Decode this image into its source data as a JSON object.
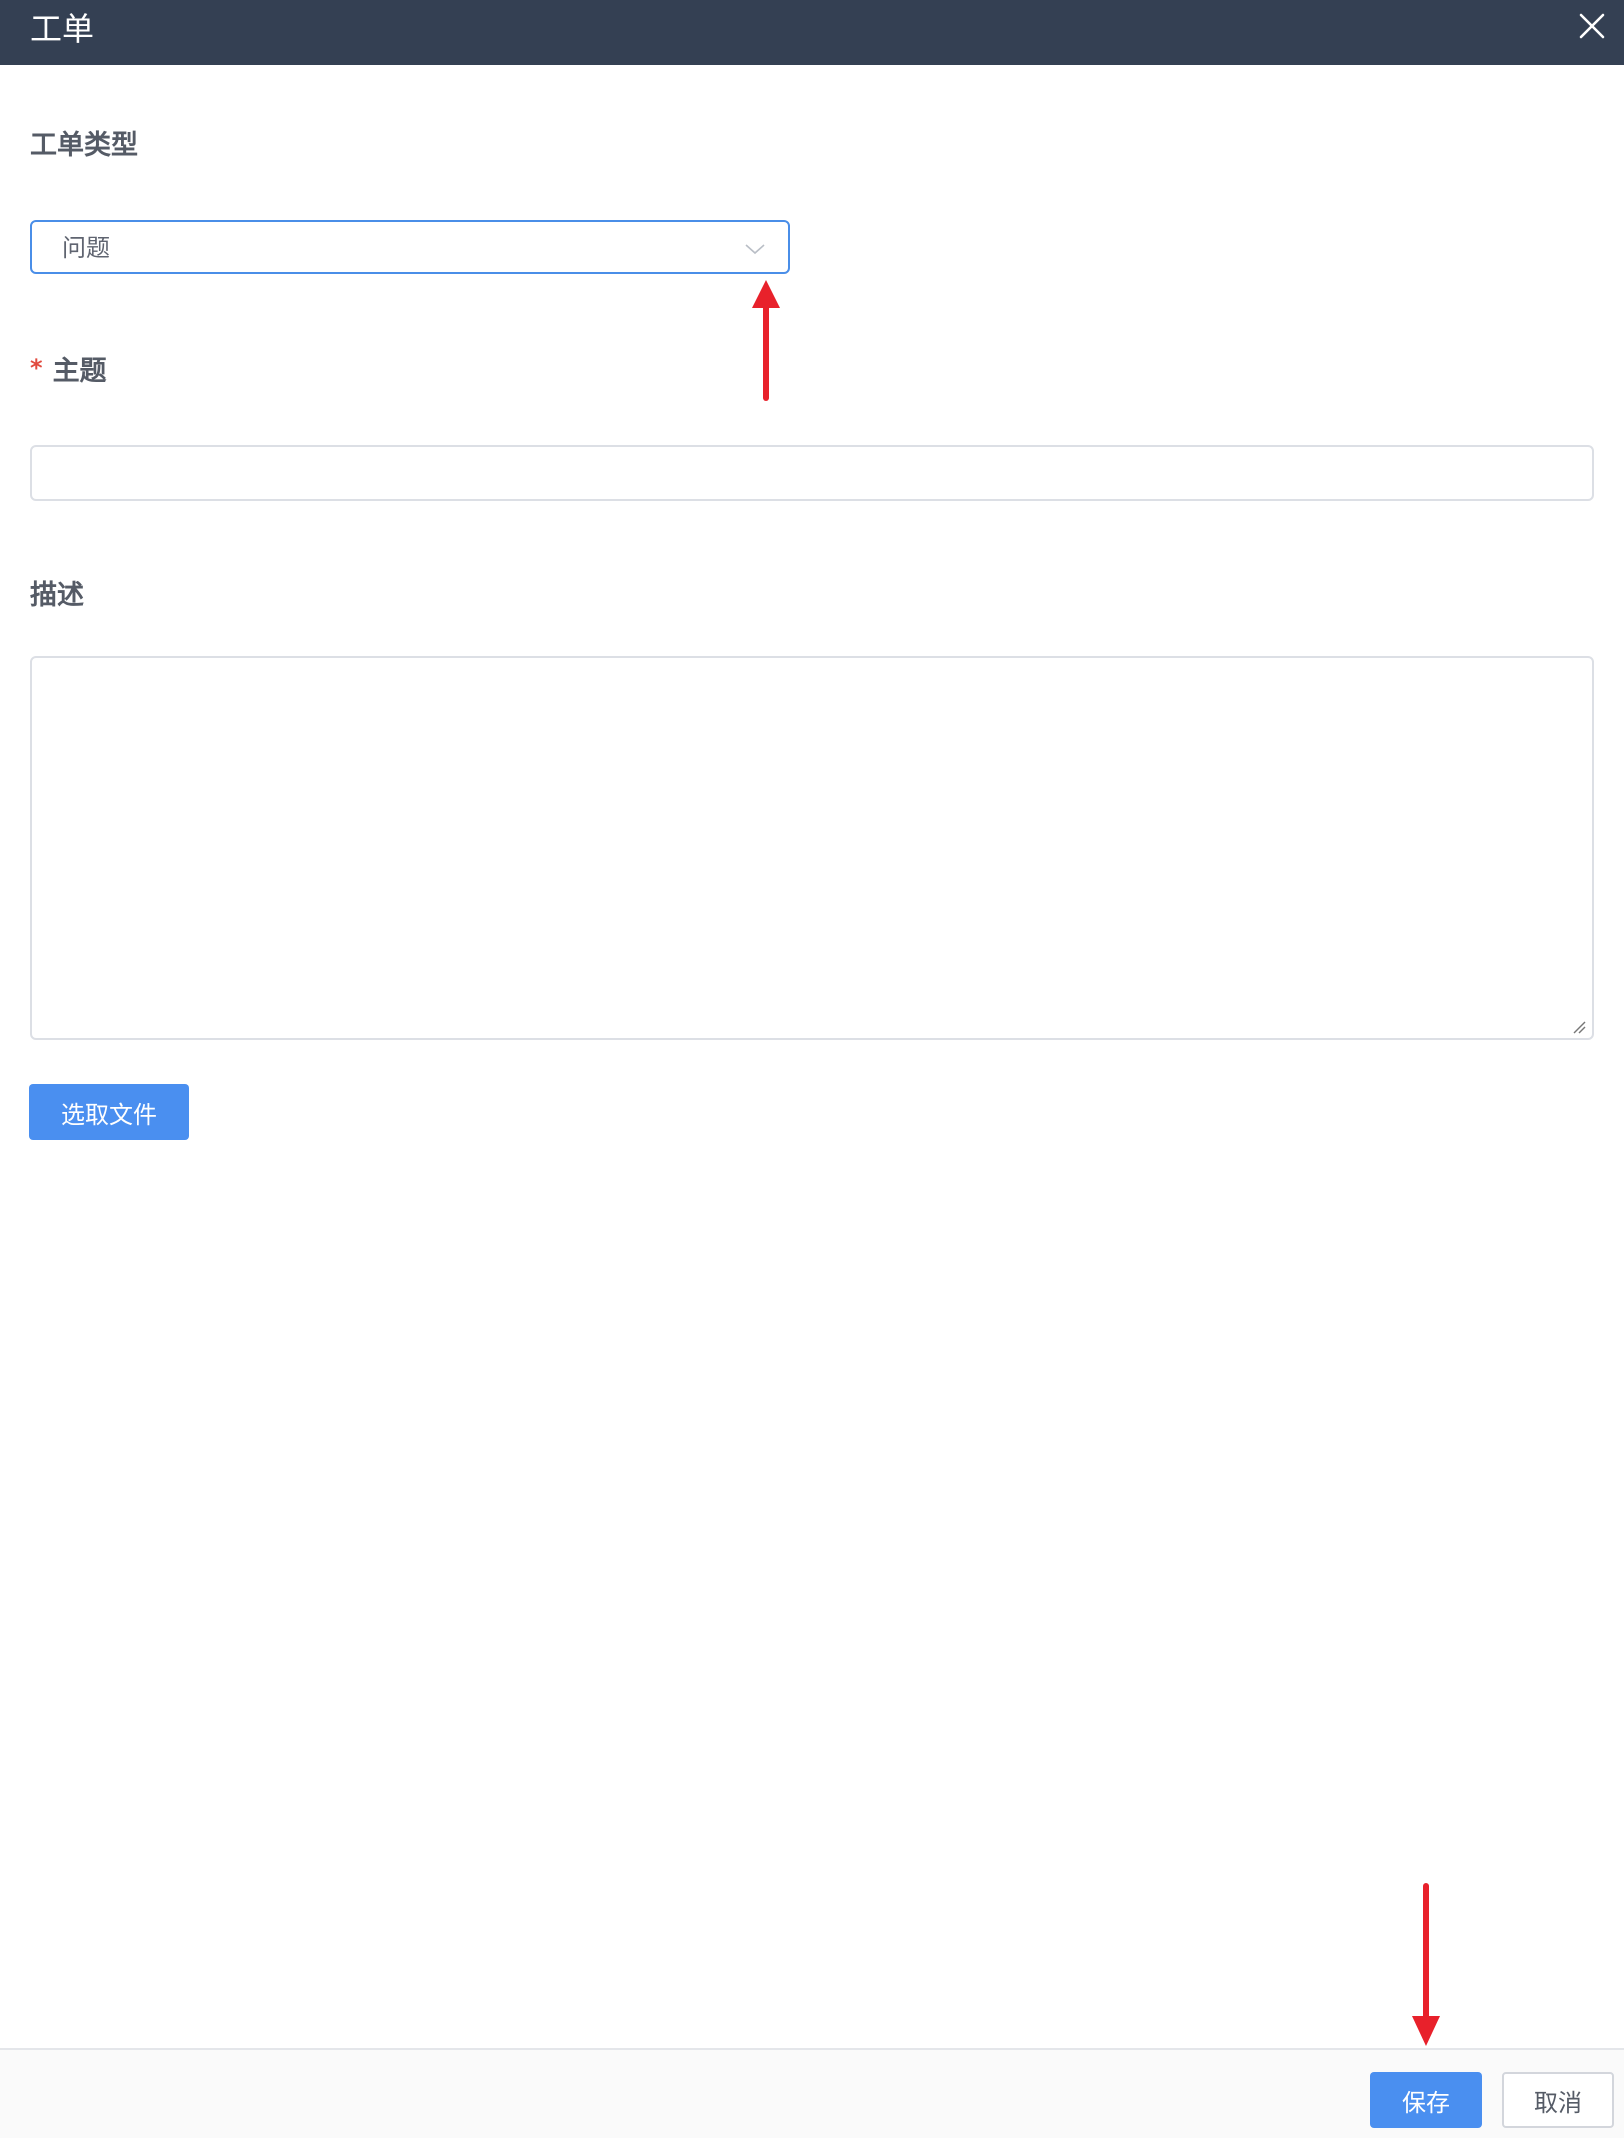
{
  "dialog": {
    "title": "工单",
    "close_icon": "close-icon"
  },
  "form": {
    "ticket_type": {
      "label": "工单类型",
      "selected": "问题",
      "chevron_icon": "chevron-down-icon"
    },
    "subject": {
      "required_mark": "*",
      "label": "主题",
      "value": ""
    },
    "description": {
      "label": "描述",
      "value": ""
    },
    "file_button_label": "选取文件"
  },
  "footer": {
    "save_label": "保存",
    "cancel_label": "取消"
  },
  "annotations": {
    "arrow_color": "#e8212b"
  },
  "colors": {
    "header_bg": "#344053",
    "primary": "#4a8ff0",
    "focus_border": "#4a8ee8"
  }
}
